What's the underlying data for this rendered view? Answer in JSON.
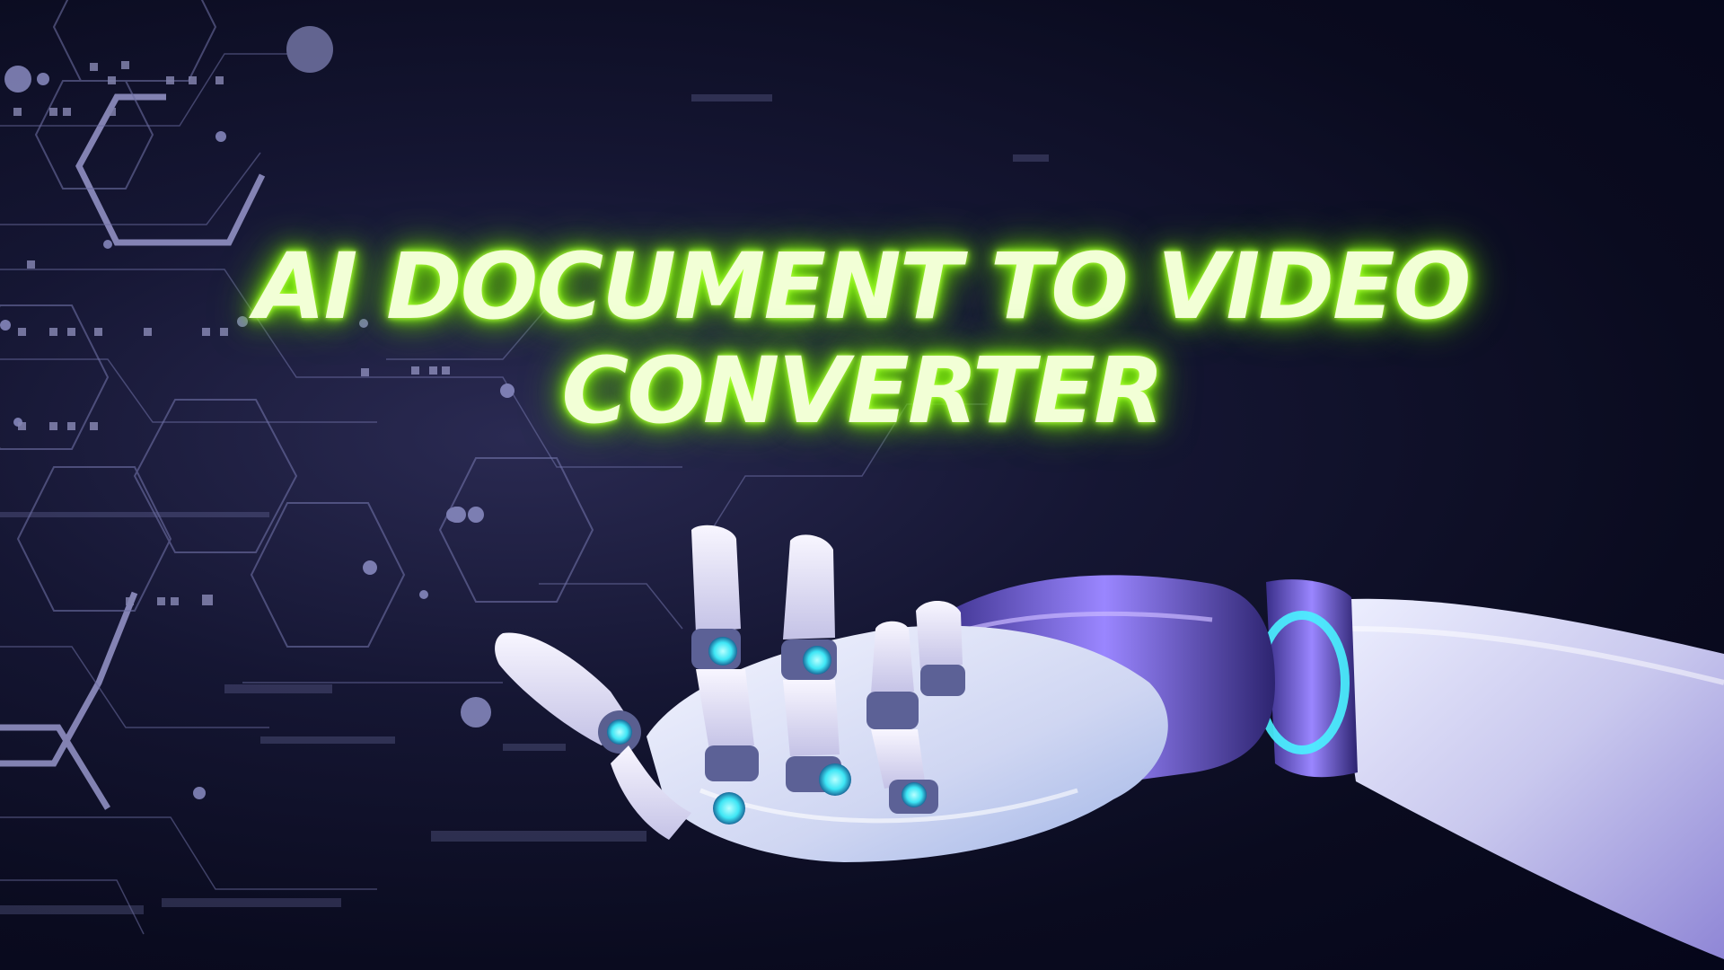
{
  "headline": {
    "line1": "AI DOCUMENT TO VIDEO",
    "line2": "CONVERTER"
  },
  "colors": {
    "background": "#0a0b1f",
    "headline_text": "#f2ffd6",
    "headline_glow": "#8cff1a",
    "circuit_lines": "#8a8cc8",
    "robot_hand": "#dcdcf0",
    "robot_accent": "#7b5cff",
    "joint_glow": "#4ff0ff"
  },
  "images": [
    "circuit-hexagon-pattern",
    "robot-hand"
  ]
}
